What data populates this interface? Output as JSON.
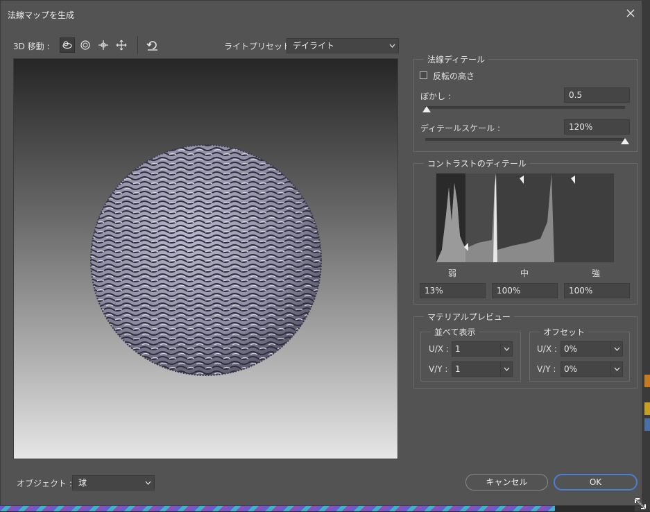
{
  "dialog": {
    "title": "法線マップを生成"
  },
  "toolbar": {
    "move3d_label": "3D 移動 :",
    "light_preset_label": "ライトプリセット :",
    "light_preset_value": "デイライト"
  },
  "normal_detail": {
    "title": "法線ディテール",
    "invert_height_label": "反転の高さ",
    "invert_height_checked": false,
    "blur_label": "ぼかし :",
    "blur_value": "0.5",
    "blur_slider_fraction": 0.0,
    "detail_scale_label": "ディテールスケール :",
    "detail_scale_value": "120%",
    "detail_scale_slider_fraction": 1.0
  },
  "contrast_detail": {
    "title": "コントラストのディテール",
    "weak_label": "弱",
    "mid_label": "中",
    "strong_label": "強",
    "weak_value": "13%",
    "mid_value": "100%",
    "strong_value": "100%"
  },
  "material_preview": {
    "title": "マテリアルプレビュー",
    "tile_group_title": "並べて表示",
    "offset_group_title": "オフセット",
    "ux_label": "U/X :",
    "vy_label": "V/Y :",
    "tile_ux": "1",
    "tile_vy": "1",
    "offset_ux": "0%",
    "offset_vy": "0%"
  },
  "footer": {
    "object_label": "オブジェクト :",
    "object_value": "球",
    "cancel_label": "キャンセル",
    "ok_label": "OK"
  },
  "colors": {
    "dialog_bg": "#535353",
    "accent_ok_border": "#4a7fd6",
    "sphere_tint": "#9a98b0"
  },
  "icons": [
    "close-icon",
    "orbit-icon",
    "roll-icon",
    "pan-icon",
    "slide-icon",
    "reset-view-icon",
    "chevron-down-icon",
    "resize-grip-icon"
  ]
}
